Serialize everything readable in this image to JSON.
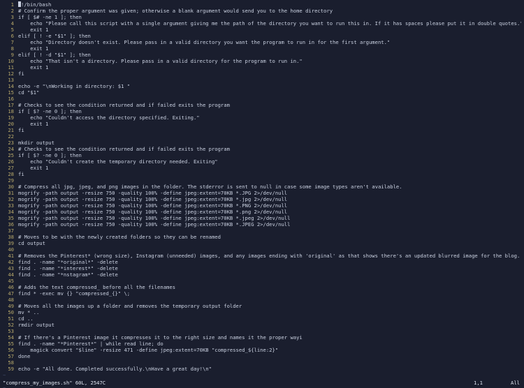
{
  "lines": [
    "#!/bin/bash",
    "# Confirm the proper argument was given; otherwise a blank argument would send you to the home directory",
    "if [ $# -ne 1 ]; then",
    "    echo \"Please call this script with a single argument giving me the path of the directory you want to run this in. If it has spaces please put it in double quotes.\"",
    "    exit 1",
    "elif [ ! -e \"$1\" ]; then",
    "    echo \"Directory doesn't exist. Please pass in a valid directory you want the program to run in for the first argument.\"",
    "    exit 1",
    "elif [ ! -d \"$1\" ]; then",
    "    echo \"That isn't a directory. Please pass in a valid directory for the program to run in.\"",
    "    exit 1",
    "fi",
    "",
    "echo -e \"\\nWorking in directory: $1 \"",
    "cd \"$1\"",
    "",
    "# Checks to see the condition returned and if failed exits the program",
    "if [ $? -ne 0 ]; then",
    "    echo \"Couldn't access the directory specified. Exiting.\"",
    "    exit 1",
    "fi",
    "",
    "mkdir output",
    "# Checks to see the condition returned and if failed exits the program",
    "if [ $? -ne 0 ]; then",
    "    echo \"Couldn't create the temporary directory needed. Exiting\"",
    "    exit 1",
    "fi",
    "",
    "# Compress all jpg, jpeg, and png images in the folder. The stderror is sent to null in case some image types aren't available.",
    "mogrify -path output -resize 750 -quality 100% -define jpeg:extent=70KB *.JPG 2>/dev/null",
    "mogrify -path output -resize 750 -quality 100% -define jpeg:extent=70KB *.jpg 2>/dev/null",
    "mogrify -path output -resize 750 -quality 100% -define jpeg:extent=70KB *.PNG 2>/dev/null",
    "mogrify -path output -resize 750 -quality 100% -define jpeg:extent=70KB *.png 2>/dev/null",
    "mogrify -path output -resize 750 -quality 100% -define jpeg:extent=70KB *.jpeg 2>/dev/null",
    "mogrify -path output -resize 750 -quality 100% -define jpeg:extent=70KB *.JPEG 2>/dev/null",
    "",
    "# Moves to be with the newly created folders so they can be renamed",
    "cd output",
    "",
    "# Removes the Pinterest* (wrong size), Instagram (unneeded) images, and any images ending with 'original' as that shows there's an updated blurred image for the blog.",
    "find . -name \"*original*\" -delete",
    "find . -name \"*interest*\" -delete",
    "find . -name \"*nstagram*\" -delete",
    "",
    "# Adds the text compressed_ before all the filenames",
    "find * -exec mv {} \"compressed_{}\" \\;",
    "",
    "# Moves all the images up a folder and removes the temporary output folder",
    "mv * ..",
    "cd ..",
    "rmdir output",
    "",
    "# If there's a Pinterest image it compresses it to the right size and names it the proper wayi",
    "find . -name \"*Pinterest*\" | while read line; do",
    "    magick convert \"$line\" -resize 471 -define jpeg:extent=70KB \"compressed_${line:2}\"",
    "done",
    "",
    "echo -e \"All done. Completed successfully.\\nHave a great day!\\n\""
  ],
  "tildes": [
    "~",
    "~",
    "~"
  ],
  "status": {
    "filename": "\"compress_my_images.sh\" 60L, 2547C",
    "position": "1,1",
    "scroll": "All"
  }
}
